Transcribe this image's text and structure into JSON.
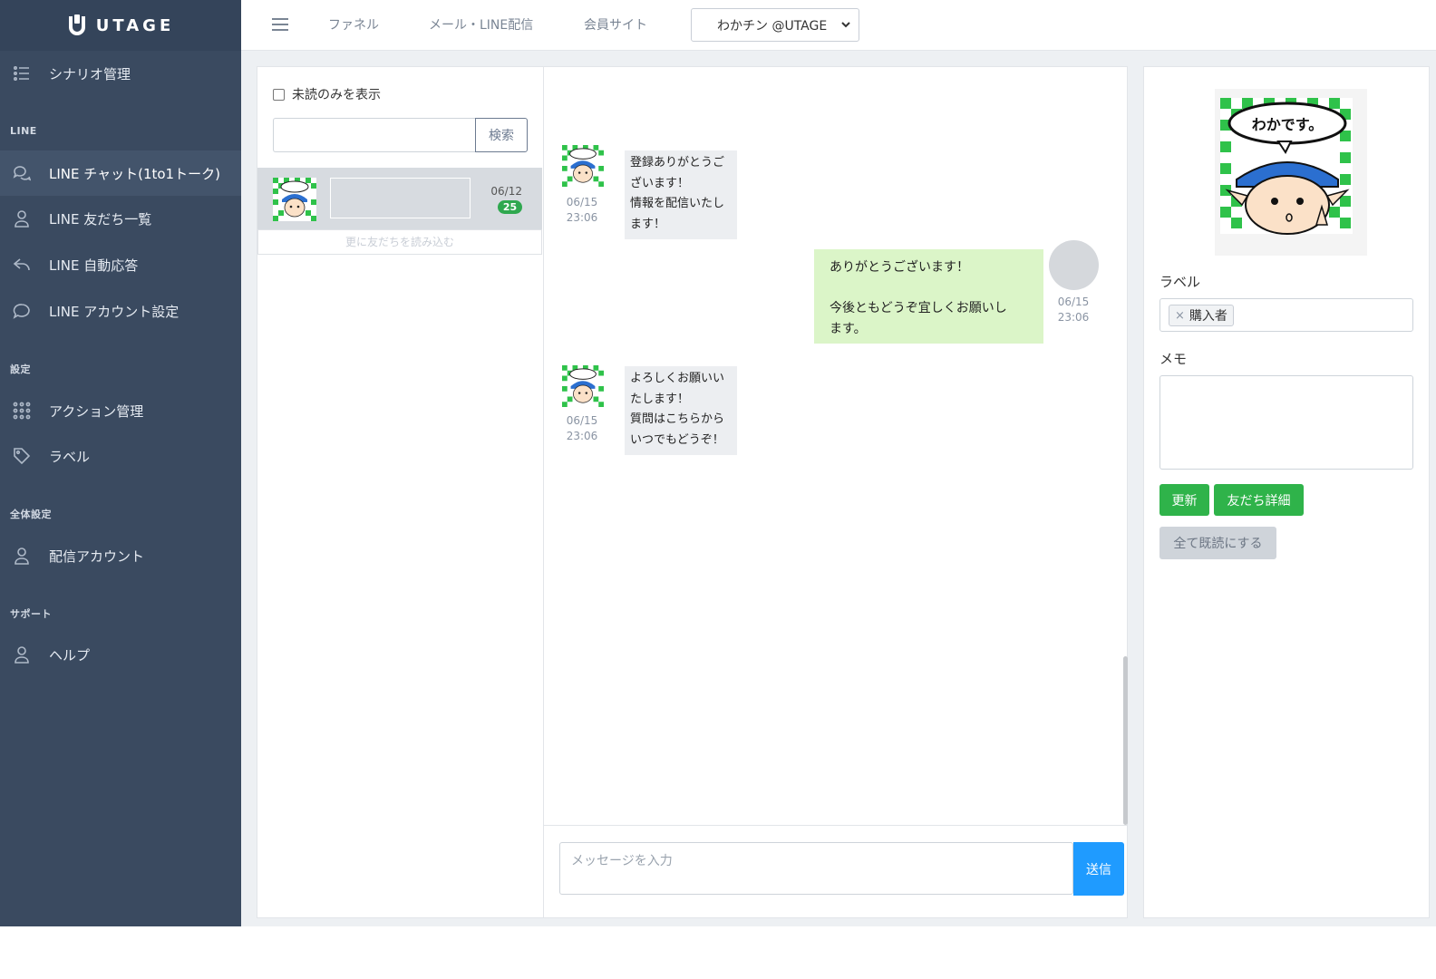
{
  "brand": {
    "name": "UTAGE"
  },
  "sidebar": {
    "items": [
      {
        "label": "シナリオ管理",
        "icon": "list-icon"
      },
      {
        "label": "LINE チャット(1to1トーク)",
        "icon": "chat-icon",
        "active": true
      },
      {
        "label": "LINE 友だち一覧",
        "icon": "user-icon"
      },
      {
        "label": "LINE 自動応答",
        "icon": "reply-icon"
      },
      {
        "label": "LINE アカウント設定",
        "icon": "comment-icon"
      },
      {
        "label": "アクション管理",
        "icon": "grid-icon"
      },
      {
        "label": "ラベル",
        "icon": "tag-icon"
      },
      {
        "label": "配信アカウント",
        "icon": "user-icon"
      },
      {
        "label": "ヘルプ",
        "icon": "user-icon"
      }
    ],
    "sections": [
      "LINE",
      "設定",
      "全体設定",
      "サポート"
    ]
  },
  "topnav": {
    "links": [
      "ファネル",
      "メール・LINE配信",
      "会員サイト"
    ],
    "account_select": "わかチン @UTAGE"
  },
  "list_panel": {
    "unread_only_label": "未読のみを表示",
    "search_button": "検索",
    "friend": {
      "date": "06/12",
      "unread_count": "25"
    },
    "load_more": "更に友だちを読み込む"
  },
  "chat": {
    "messages": [
      {
        "direction": "in",
        "date": "06/15",
        "time": "23:06",
        "text": "登録ありがとうご\nざいます！\n情報を配信いたし\nます！"
      },
      {
        "direction": "out",
        "date": "06/15",
        "time": "23:06",
        "text": "ありがとうございます！\n\n今後ともどうぞ宜しくお願いし\nます。"
      },
      {
        "direction": "in",
        "date": "06/15",
        "time": "23:06",
        "text": "よろしくお願いい\nたします！\n質問はこちらから\nいつでもどうぞ！"
      }
    ],
    "compose_placeholder": "メッセージを入力",
    "send_label": "送信"
  },
  "info_panel": {
    "label_title": "ラベル",
    "tags": [
      "購入者"
    ],
    "tag_remove": "×",
    "memo_title": "メモ",
    "update_button": "更新",
    "friend_detail_button": "友だち詳細",
    "mark_all_read_button": "全て既読にする",
    "avatar_caption": "わかです。"
  },
  "colors": {
    "sidebar": "#3a4a60",
    "accent_green": "#2fb34a",
    "send_blue": "#1f9bff",
    "out_bubble": "#dbf5c8"
  }
}
